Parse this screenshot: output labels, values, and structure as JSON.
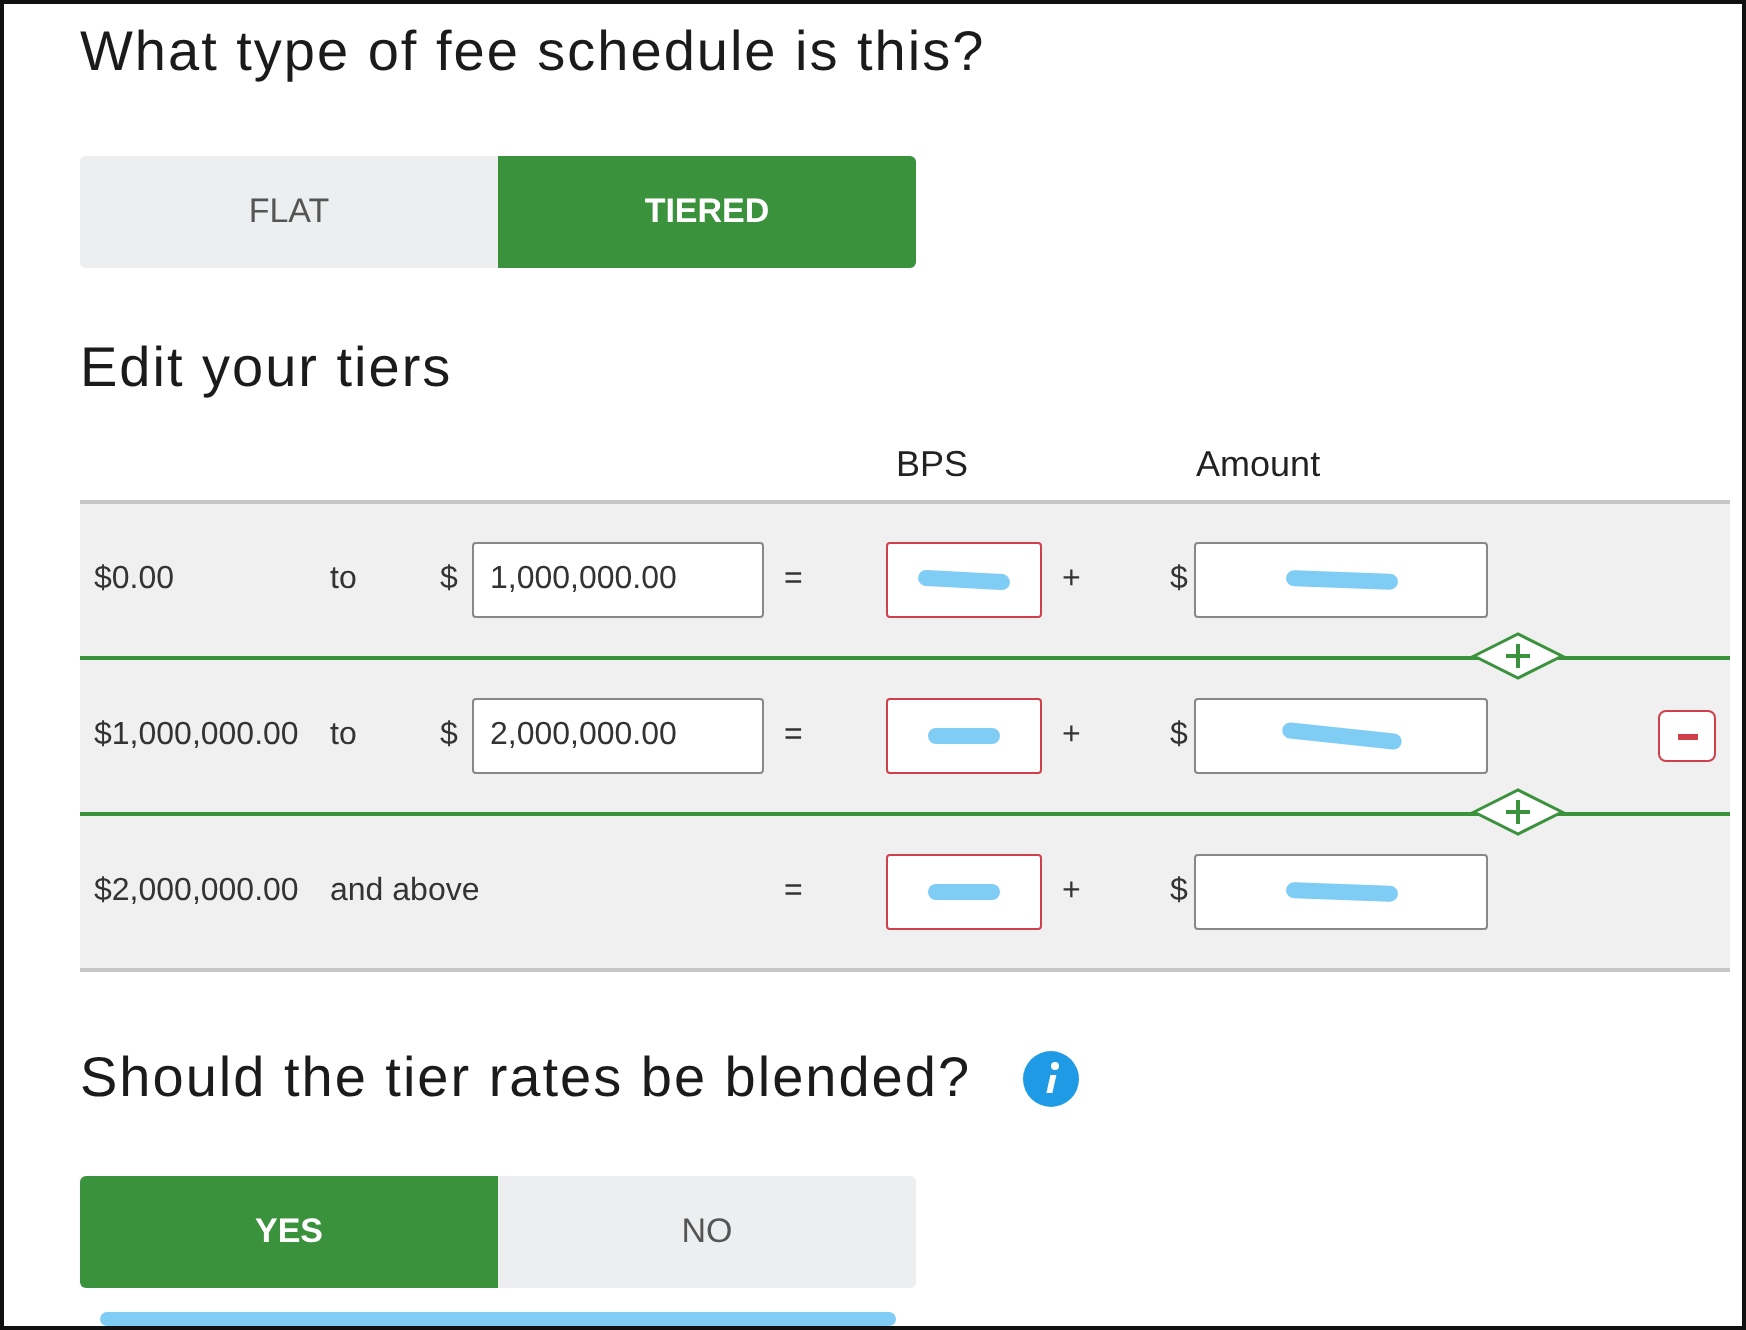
{
  "fee_type": {
    "question": "What type of fee schedule is this?",
    "options": [
      {
        "label": "FLAT",
        "selected": false
      },
      {
        "label": "TIERED",
        "selected": true
      }
    ]
  },
  "tiers": {
    "title": "Edit your tiers",
    "columns": [
      "BPS",
      "Amount"
    ],
    "rows": [
      {
        "from": "$0.00",
        "connector": "to",
        "currency": "$",
        "upper": "1,000,000.00",
        "equals": "=",
        "bps_invalid": true,
        "plus": "+",
        "amount_currency": "$",
        "removable": false
      },
      {
        "from": "$1,000,000.00",
        "connector": "to",
        "currency": "$",
        "upper": "2,000,000.00",
        "equals": "=",
        "bps_invalid": true,
        "plus": "+",
        "amount_currency": "$",
        "removable": true
      },
      {
        "from": "$2,000,000.00",
        "connector": "and above",
        "equals": "=",
        "bps_invalid": true,
        "plus": "+",
        "amount_currency": "$",
        "removable": false
      }
    ]
  },
  "blend": {
    "question": "Should the tier rates be blended?",
    "options": [
      {
        "label": "YES",
        "selected": true
      },
      {
        "label": "NO",
        "selected": false
      }
    ]
  }
}
